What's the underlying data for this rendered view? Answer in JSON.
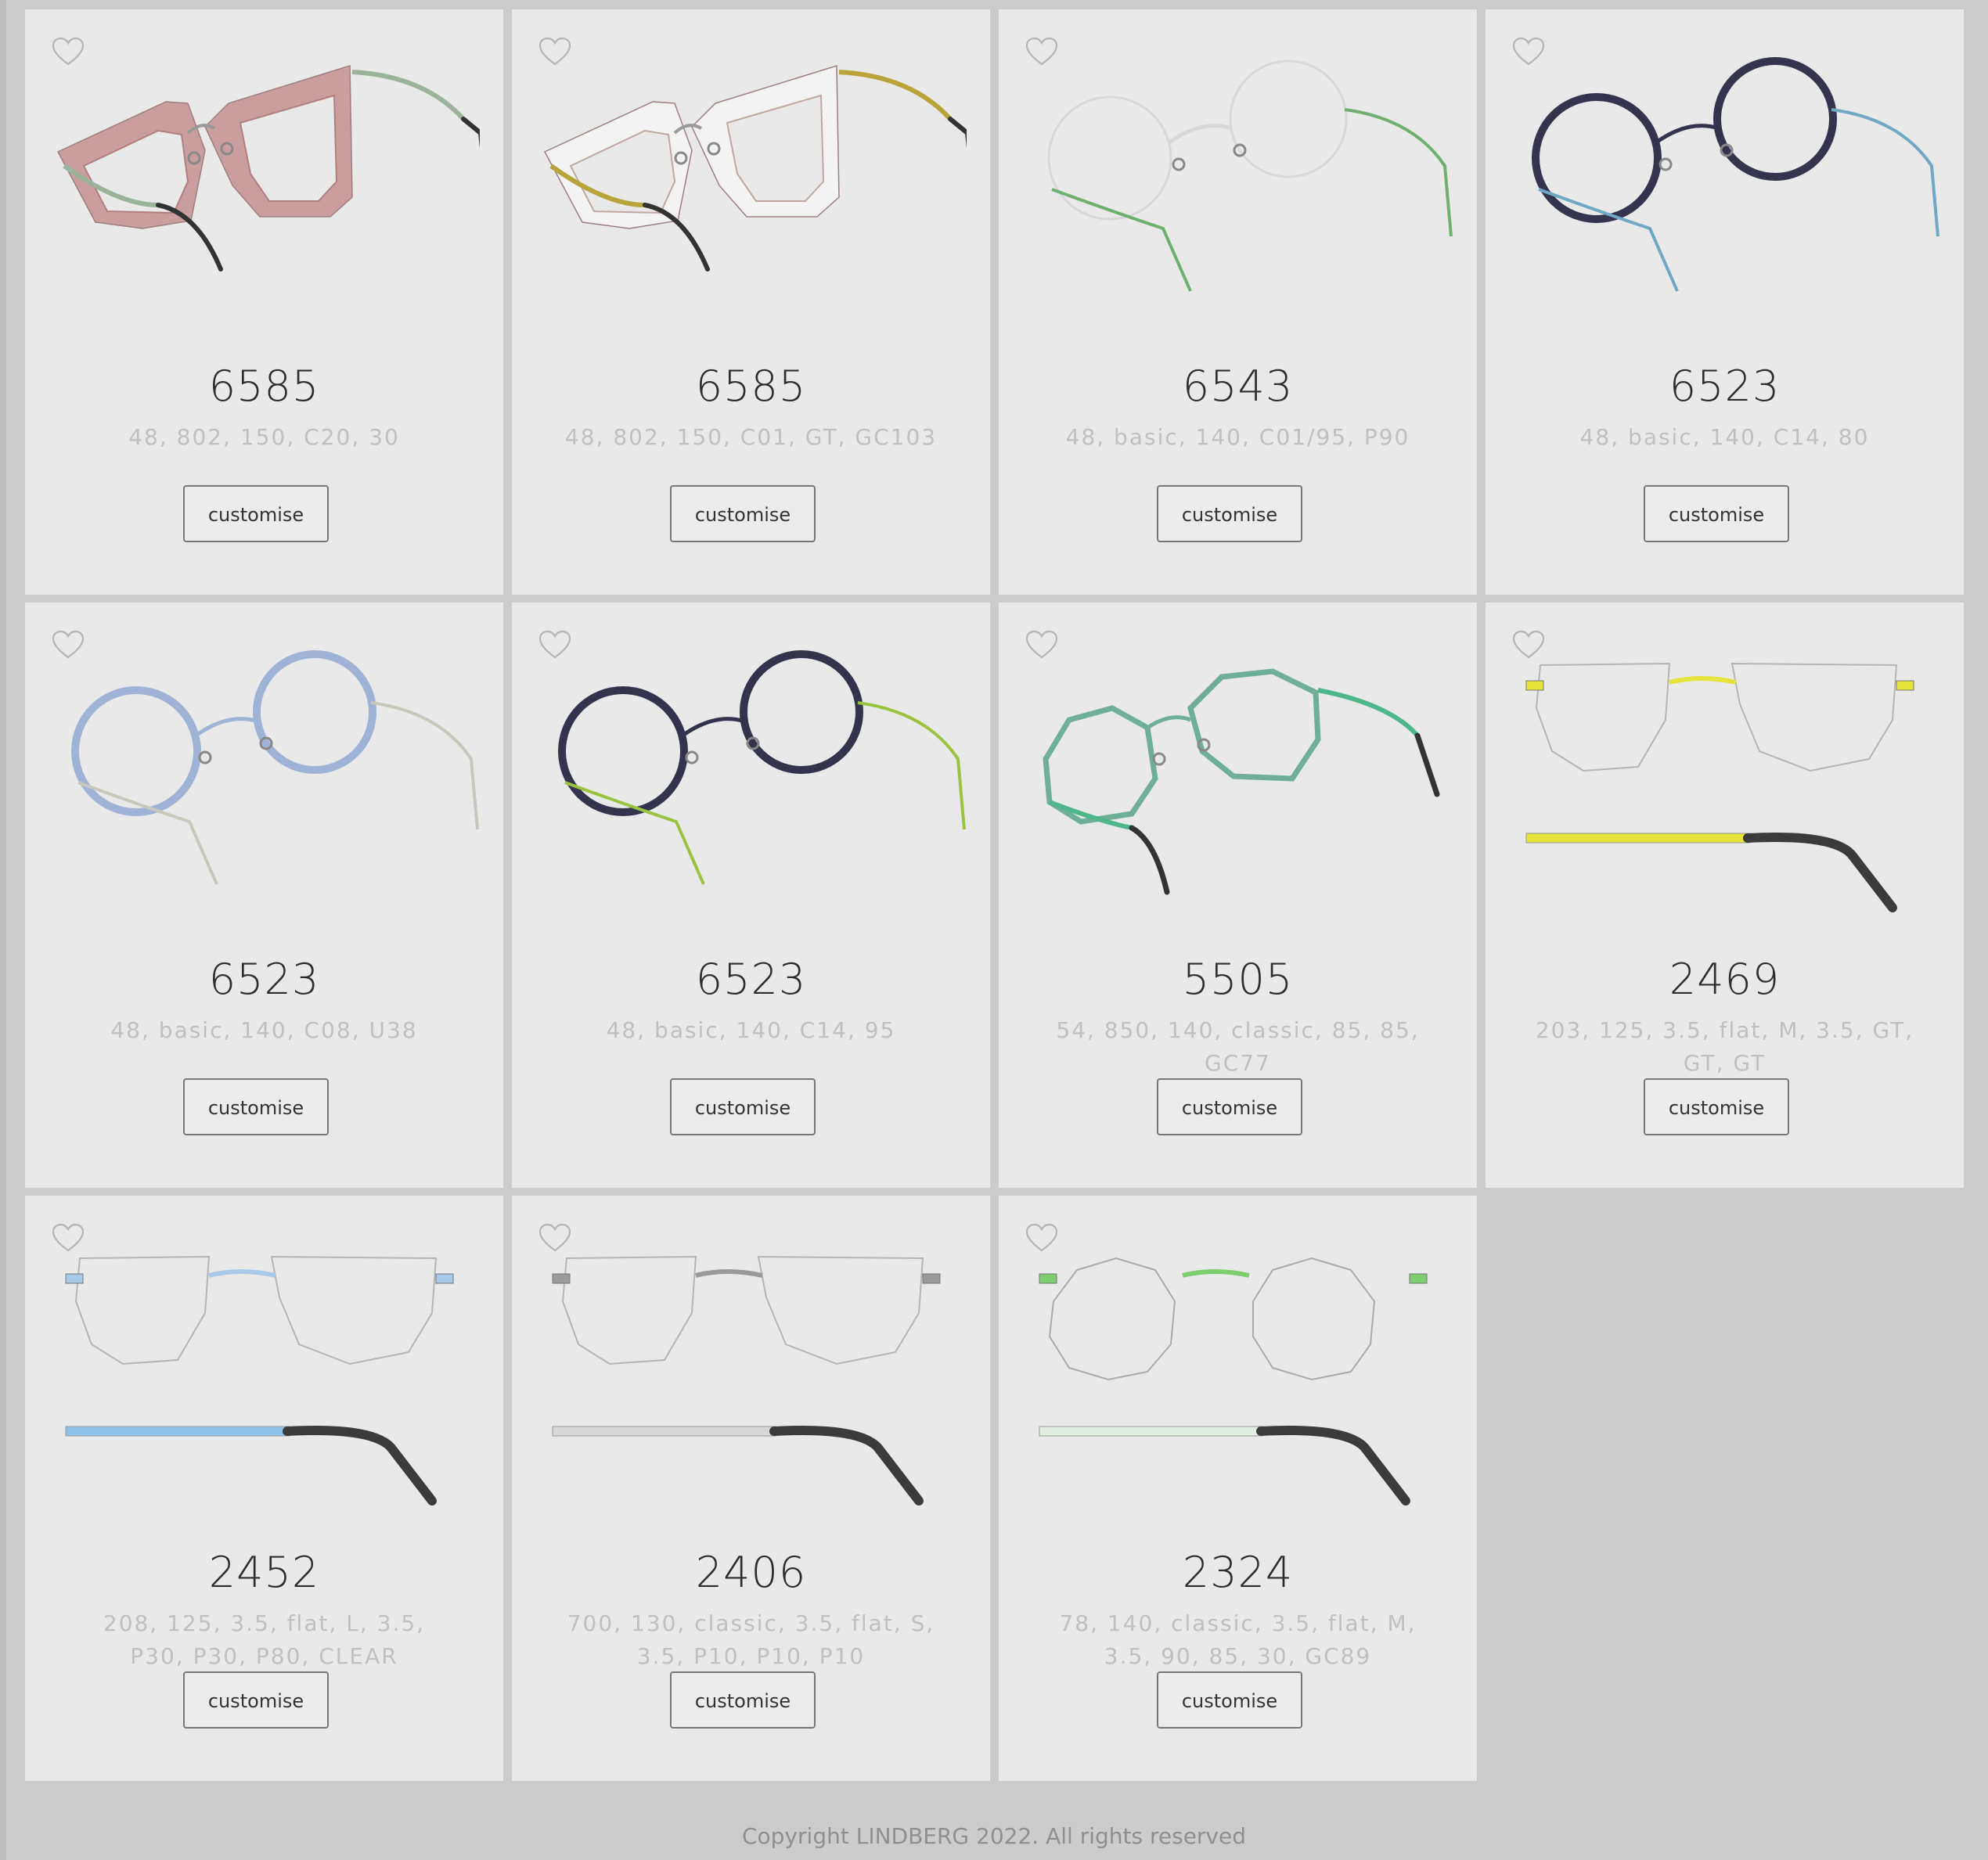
{
  "products": [
    {
      "model": "6585",
      "specs": "48, 802, 150, C20, 30",
      "button": "customise",
      "favorite_icon": "heart-outline-icon",
      "frame_type": "square-acetate",
      "rim_color": "#c99a9a",
      "temple_color": "#9ab39a"
    },
    {
      "model": "6585",
      "specs": "48, 802, 150, C01, GT, GC103",
      "button": "customise",
      "favorite_icon": "heart-outline-icon",
      "frame_type": "square-acetate",
      "rim_color": "#f2f2f2",
      "temple_color": "#b8a43a"
    },
    {
      "model": "6543",
      "specs": "48, basic, 140, C01/95, P90",
      "button": "customise",
      "favorite_icon": "heart-outline-icon",
      "frame_type": "round",
      "rim_color": "#f2f2f2",
      "temple_color": "#6fb06f"
    },
    {
      "model": "6523",
      "specs": "48, basic, 140, C14, 80",
      "button": "customise",
      "favorite_icon": "heart-outline-icon",
      "frame_type": "round",
      "rim_color": "#34344f",
      "temple_color": "#6fa7c4"
    },
    {
      "model": "6523",
      "specs": "48, basic, 140, C08, U38",
      "button": "customise",
      "favorite_icon": "heart-outline-icon",
      "frame_type": "round",
      "rim_color": "#9fb3d6",
      "temple_color": "#c7c7bb"
    },
    {
      "model": "6523",
      "specs": "48, basic, 140, C14, 95",
      "button": "customise",
      "favorite_icon": "heart-outline-icon",
      "frame_type": "round",
      "rim_color": "#33334d",
      "temple_color": "#9ac43f"
    },
    {
      "model": "5505",
      "specs": "54, 850, 140, classic, 85, 85, GC77",
      "button": "customise",
      "favorite_icon": "heart-outline-icon",
      "frame_type": "geometric",
      "rim_color": "#6fae97",
      "temple_color": "#4fb58a"
    },
    {
      "model": "2469",
      "specs": "203, 125, 3.5, flat, M, 3.5, GT, GT, GT",
      "button": "customise",
      "favorite_icon": "heart-outline-icon",
      "frame_type": "rimless",
      "rim_color": "#e6e33a",
      "temple_color": "#e6e33a"
    },
    {
      "model": "2452",
      "specs": "208, 125, 3.5, flat, L, 3.5, P30, P30, P80, CLEAR",
      "button": "customise",
      "favorite_icon": "heart-outline-icon",
      "frame_type": "rimless",
      "rim_color": "#a9c9e8",
      "temple_color": "#8fc3ec"
    },
    {
      "model": "2406",
      "specs": "700, 130, classic, 3.5, flat, S, 3.5, P10, P10, P10",
      "button": "customise",
      "favorite_icon": "heart-outline-icon",
      "frame_type": "rimless",
      "rim_color": "#9a9a9a",
      "temple_color": "#d8d8d8"
    },
    {
      "model": "2324",
      "specs": "78, 140, classic, 3.5, flat, M, 3.5, 90, 85, 30, GC89",
      "button": "customise",
      "favorite_icon": "heart-outline-icon",
      "frame_type": "rimless",
      "rim_color": "#7ccf6c",
      "temple_color": "#e2eee2"
    }
  ],
  "footer": {
    "copyright": "Copyright LINDBERG 2022. All rights reserved"
  }
}
